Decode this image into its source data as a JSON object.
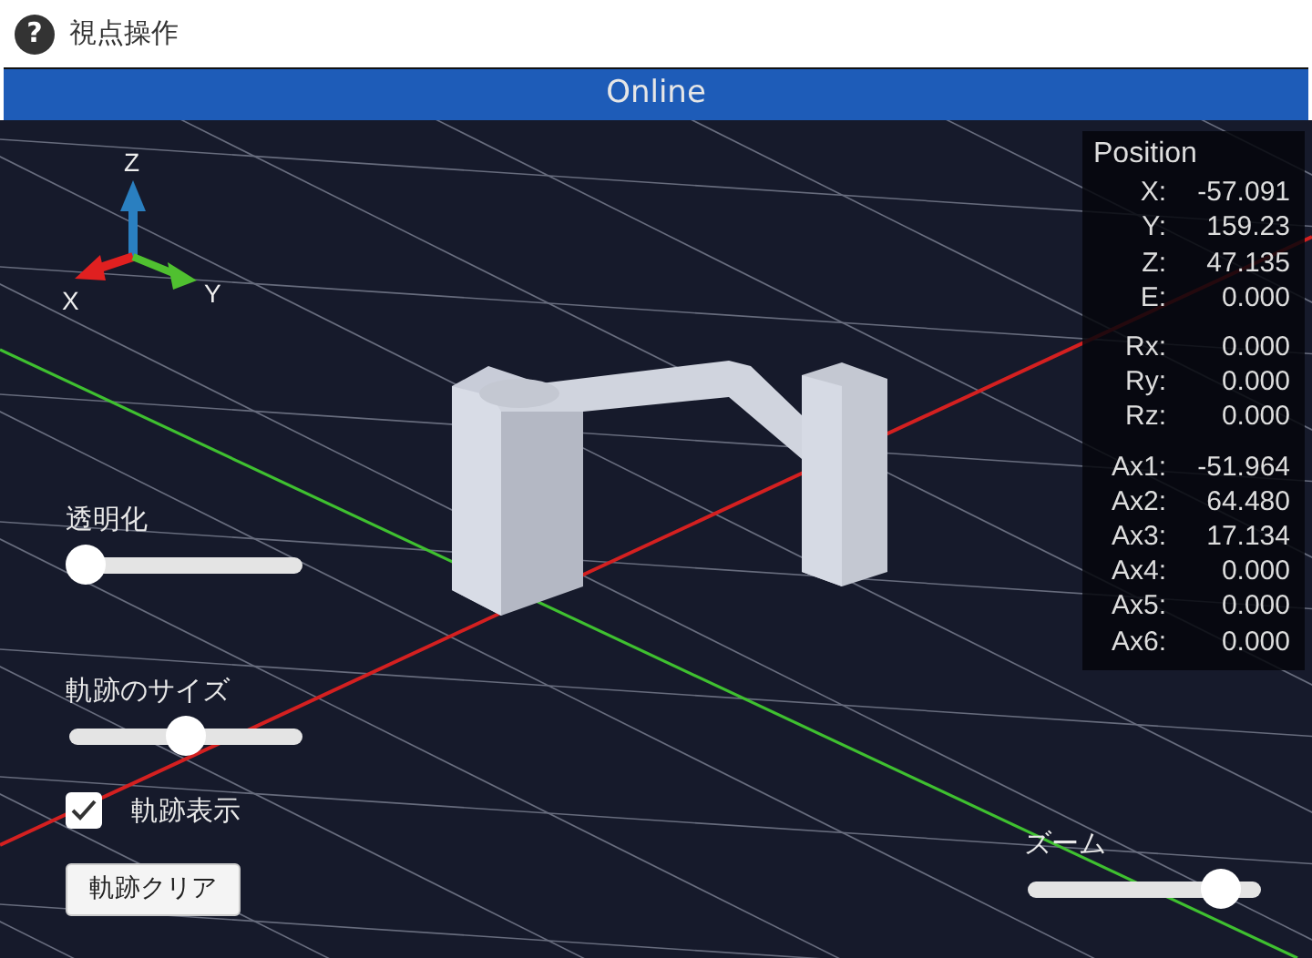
{
  "window": {
    "title": "視点操作",
    "help_icon": "?"
  },
  "status_bar": {
    "text": "Online"
  },
  "axes_gizmo": {
    "labels": [
      "Z",
      "X",
      "Y"
    ]
  },
  "position": {
    "title": "Position",
    "groups": [
      [
        {
          "label": "X:",
          "value": "-57.091"
        },
        {
          "label": "Y:",
          "value": "159.23"
        },
        {
          "label": "Z:",
          "value": "47.135"
        },
        {
          "label": "E:",
          "value": "0.000"
        }
      ],
      [
        {
          "label": "Rx:",
          "value": "0.000"
        },
        {
          "label": "Ry:",
          "value": "0.000"
        },
        {
          "label": "Rz:",
          "value": "0.000"
        }
      ],
      [
        {
          "label": "Ax1:",
          "value": "-51.964"
        },
        {
          "label": "Ax2:",
          "value": "64.480"
        },
        {
          "label": "Ax3:",
          "value": "17.134"
        },
        {
          "label": "Ax4:",
          "value": "0.000"
        },
        {
          "label": "Ax5:",
          "value": "0.000"
        },
        {
          "label": "Ax6:",
          "value": "0.000"
        }
      ]
    ]
  },
  "controls": [
    {
      "kind": "slider",
      "label": "透明化",
      "level": 0
    },
    {
      "kind": "slider",
      "label": "軌跡のサイズ",
      "level": 0.5
    },
    {
      "kind": "checkbox",
      "label": "軌跡表示",
      "checked": true
    },
    {
      "kind": "button",
      "label": "軌跡クリア"
    }
  ],
  "zoom": {
    "label": "ズーム",
    "level": 0.88
  }
}
